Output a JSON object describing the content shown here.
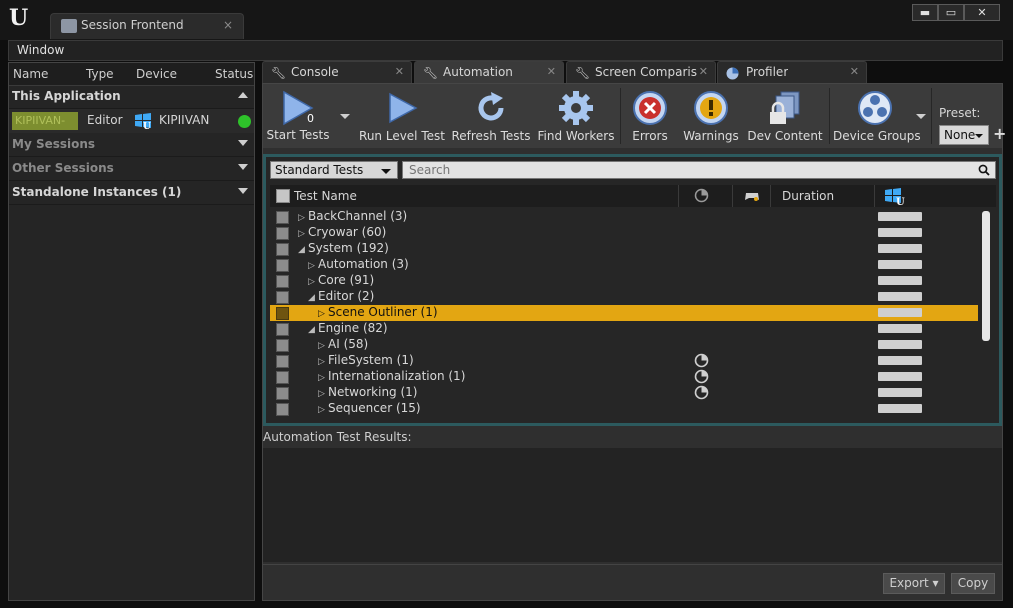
{
  "window": {
    "tab_title": "Session Frontend",
    "tab_close": "×",
    "controls": {
      "minimize": "▬",
      "maximize": "▭",
      "close": "✕"
    }
  },
  "menu": {
    "window_label": "Window"
  },
  "sessions": {
    "columns": {
      "name": "Name",
      "type": "Type",
      "device": "Device",
      "status": "Status"
    },
    "groups": [
      {
        "label": "This Application",
        "expanded": true
      },
      {
        "label": "My Sessions",
        "expanded": false
      },
      {
        "label": "Other Sessions",
        "expanded": false
      },
      {
        "label": "Standalone Instances (1)",
        "expanded": false
      }
    ],
    "instance": {
      "name": "KIPIIVAN-",
      "type": "Editor",
      "device": "KIPIIVAN",
      "status_color": "#2ec22a"
    }
  },
  "tabs": [
    {
      "label": "Console",
      "icon": "wrench-icon",
      "active": false
    },
    {
      "label": "Automation",
      "icon": "wrench-icon",
      "active": true
    },
    {
      "label": "Screen Comparison",
      "icon": "wrench-icon",
      "active": false
    },
    {
      "label": "Profiler",
      "icon": "profiler-icon",
      "active": false
    }
  ],
  "toolbar": {
    "start_tests": "Start Tests",
    "start_count": "0",
    "run_level_test": "Run Level Test",
    "refresh_tests": "Refresh Tests",
    "find_workers": "Find Workers",
    "errors": "Errors",
    "warnings": "Warnings",
    "dev_content": "Dev Content",
    "device_groups": "Device Groups",
    "preset_label": "Preset:",
    "preset_value": "None",
    "add_symbol": "+"
  },
  "filter": {
    "selected": "Standard Tests",
    "search_placeholder": "Search"
  },
  "grid": {
    "columns": {
      "name": "Test Name",
      "duration": "Duration"
    },
    "rows": [
      {
        "label": "BackChannel (3)",
        "depth": 0,
        "expander": "▷",
        "selected": false,
        "has_icon": false
      },
      {
        "label": "Cryowar (60)",
        "depth": 0,
        "expander": "▷",
        "selected": false,
        "has_icon": false
      },
      {
        "label": "System (192)",
        "depth": 0,
        "expander": "◢",
        "selected": false,
        "has_icon": false
      },
      {
        "label": "Automation (3)",
        "depth": 1,
        "expander": "▷",
        "selected": false,
        "has_icon": false
      },
      {
        "label": "Core (91)",
        "depth": 1,
        "expander": "▷",
        "selected": false,
        "has_icon": false
      },
      {
        "label": "Editor (2)",
        "depth": 1,
        "expander": "◢",
        "selected": false,
        "has_icon": false
      },
      {
        "label": "Scene Outliner (1)",
        "depth": 2,
        "expander": "▷",
        "selected": true,
        "has_icon": false
      },
      {
        "label": "Engine (82)",
        "depth": 1,
        "expander": "◢",
        "selected": false,
        "has_icon": false
      },
      {
        "label": "AI (58)",
        "depth": 2,
        "expander": "▷",
        "selected": false,
        "has_icon": false
      },
      {
        "label": "FileSystem (1)",
        "depth": 2,
        "expander": "▷",
        "selected": false,
        "has_icon": true
      },
      {
        "label": "Internationalization (1)",
        "depth": 2,
        "expander": "▷",
        "selected": false,
        "has_icon": true
      },
      {
        "label": "Networking (1)",
        "depth": 2,
        "expander": "▷",
        "selected": false,
        "has_icon": true
      },
      {
        "label": "Sequencer (15)",
        "depth": 2,
        "expander": "▷",
        "selected": false,
        "has_icon": false
      }
    ]
  },
  "results": {
    "label": "Automation Test Results:"
  },
  "footer": {
    "export": "Export",
    "copy": "Copy"
  },
  "colors": {
    "selection": "#e3a612",
    "frame": "#2c5a5e",
    "status_ok": "#2ec22a",
    "instance_bg": "#7d8e2f"
  }
}
